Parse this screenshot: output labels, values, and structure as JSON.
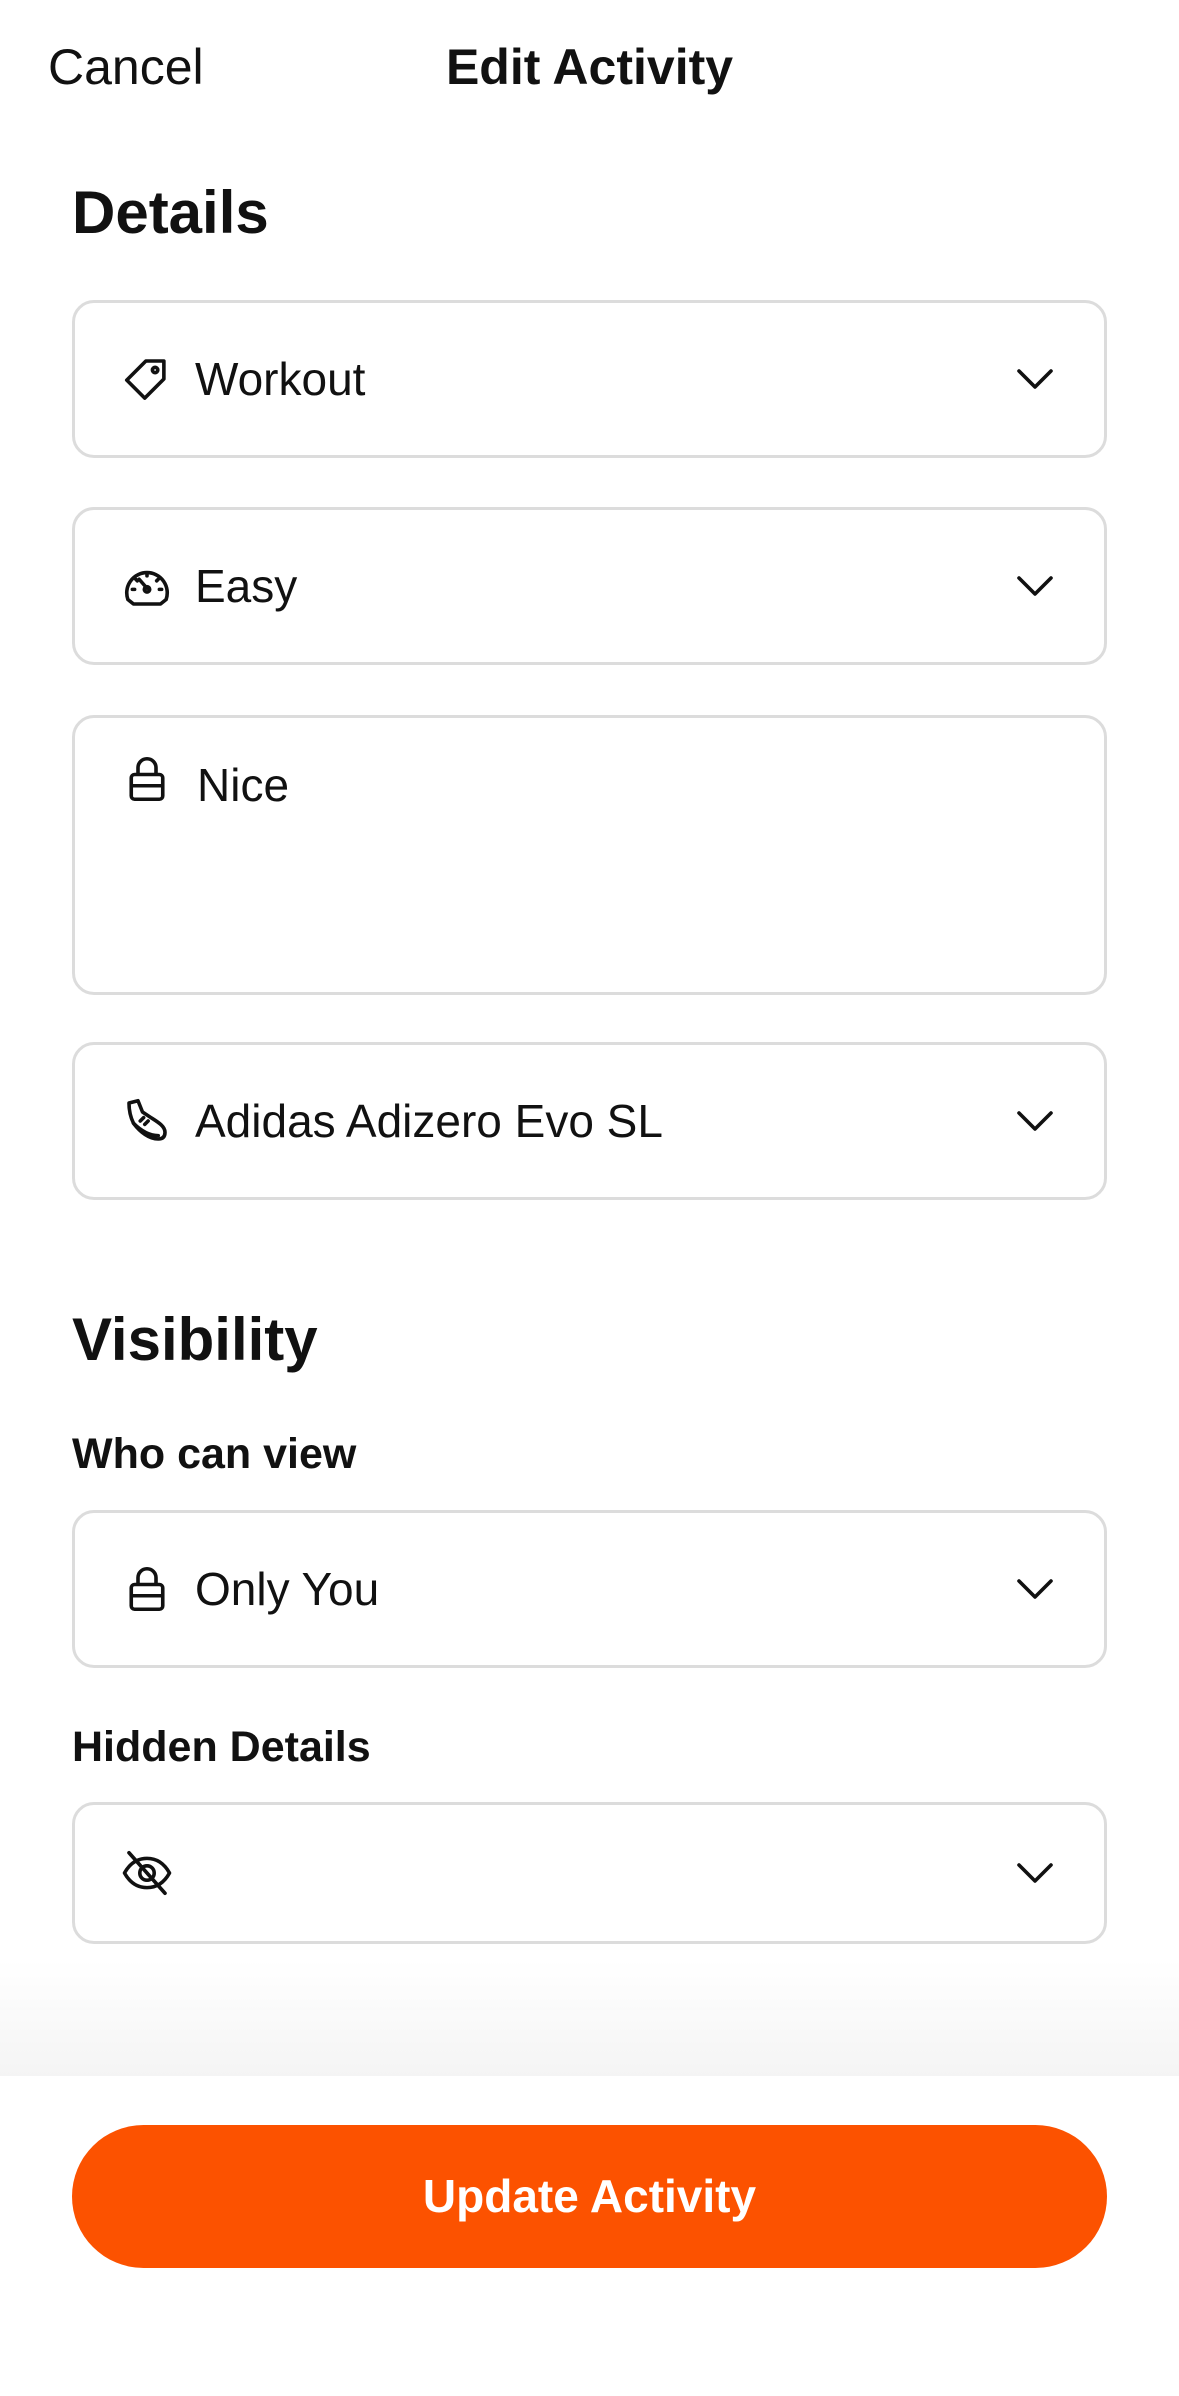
{
  "header": {
    "cancel_label": "Cancel",
    "title": "Edit Activity"
  },
  "details": {
    "section_title": "Details",
    "activity_type": {
      "value": "Workout",
      "icon": "tag-icon"
    },
    "effort": {
      "value": "Easy",
      "icon": "speedometer-icon"
    },
    "private_notes": {
      "value": "Nice",
      "icon": "lock-icon"
    },
    "gear": {
      "value": "Adidas Adizero Evo SL",
      "icon": "shoe-icon"
    }
  },
  "visibility": {
    "section_title": "Visibility",
    "who_can_view_label": "Who can view",
    "who_can_view": {
      "value": "Only You",
      "icon": "lock-icon"
    },
    "hidden_details_label": "Hidden Details",
    "hidden_details": {
      "value": "",
      "icon": "eye-off-icon"
    }
  },
  "footer": {
    "update_label": "Update Activity"
  },
  "colors": {
    "accent": "#fc5200",
    "border": "#dcdcdc",
    "text": "#111111"
  }
}
